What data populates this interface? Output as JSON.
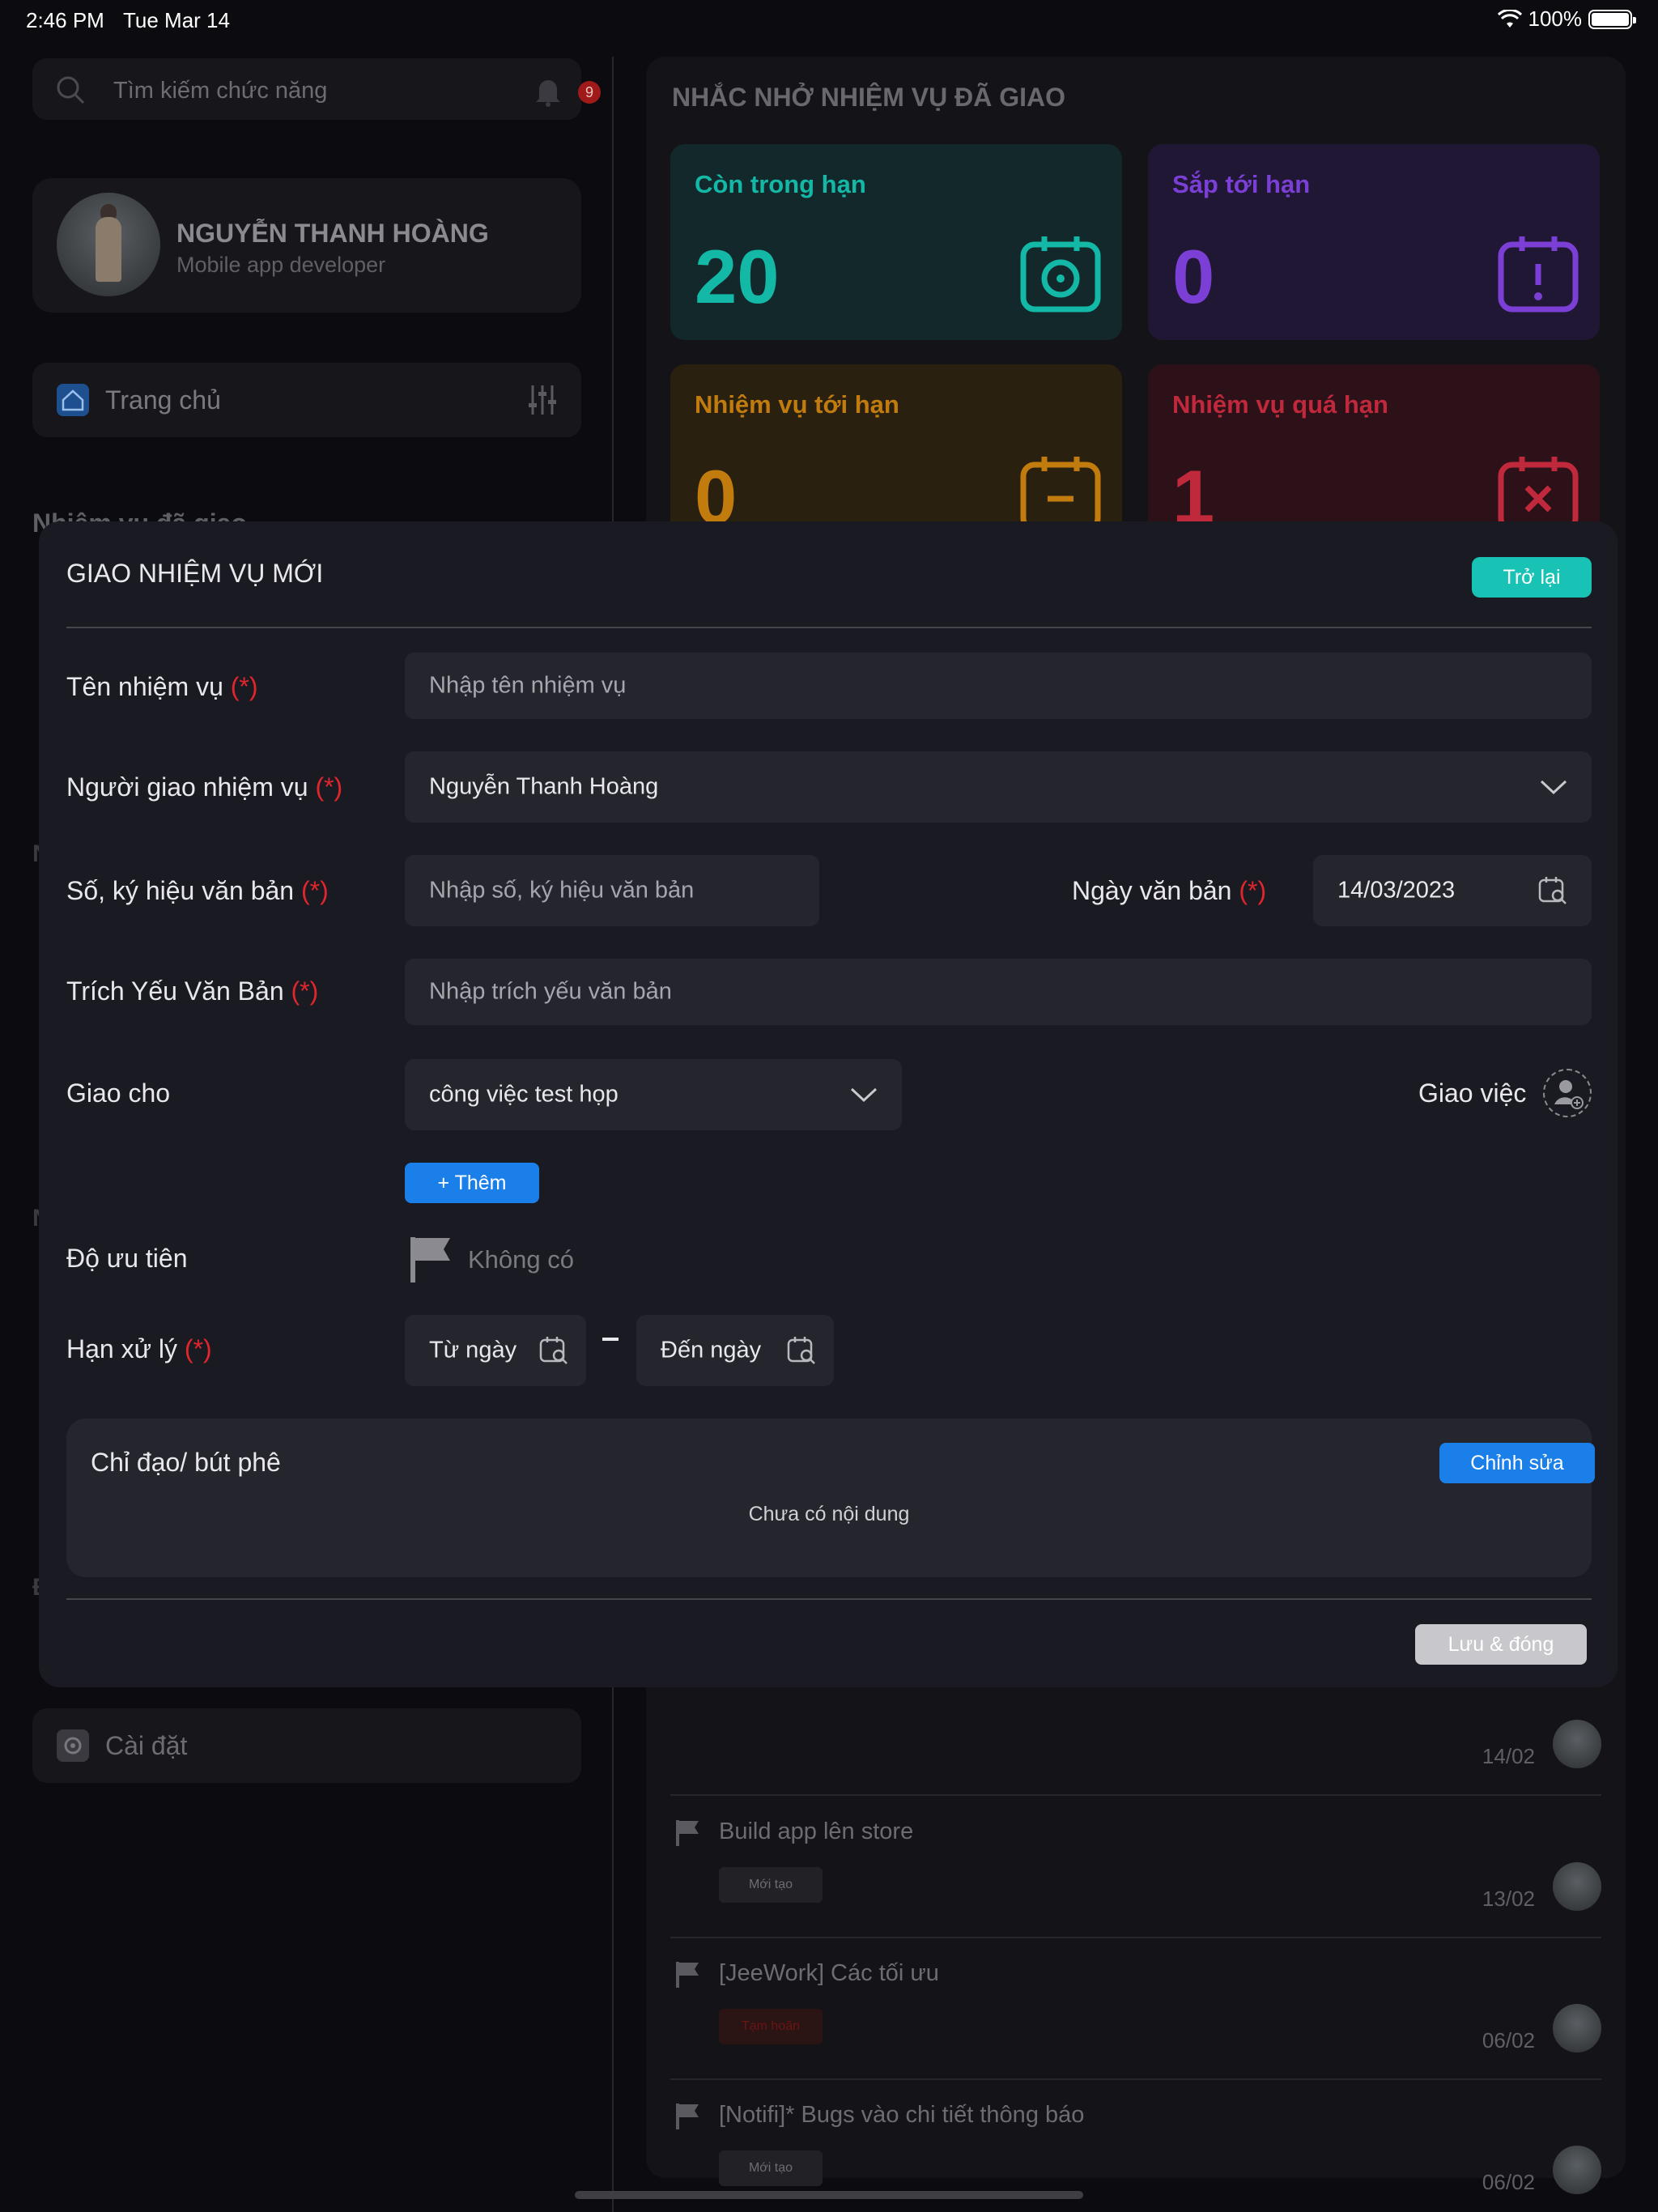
{
  "status_bar": {
    "time": "2:46 PM",
    "date": "Tue Mar 14",
    "battery": "100%"
  },
  "sidebar": {
    "search_placeholder": "Tìm kiếm chức năng",
    "notification_count": "9",
    "profile": {
      "name": "NGUYỄN THANH HOÀNG",
      "role": "Mobile app developer"
    },
    "home_label": "Trang chủ",
    "section_title": "Nhiệm vụ đã giao",
    "partial_letters": [
      "N",
      "N",
      "Đ"
    ],
    "settings_label": "Cài đặt"
  },
  "reminder": {
    "title": "NHẮC NHỞ NHIỆM VỤ ĐÃ GIAO",
    "cards": [
      {
        "label": "Còn trong hạn",
        "value": "20",
        "color": "#14b8a6",
        "bg": "#12282b",
        "icon": "alarm-clock-icon"
      },
      {
        "label": "Sắp tới hạn",
        "value": "0",
        "color": "#7b3fd6",
        "bg": "#1f1733",
        "icon": "calendar-alert-icon"
      },
      {
        "label": "Nhiệm vụ tới hạn",
        "value": "0",
        "color": "#c27c0e",
        "bg": "#2a2010",
        "icon": "calendar-minus-icon"
      },
      {
        "label": "Nhiệm vụ quá hạn",
        "value": "1",
        "color": "#c0283c",
        "bg": "#2c1118",
        "icon": "calendar-x-icon"
      }
    ]
  },
  "tasks": [
    {
      "title": "",
      "badge": "",
      "date": "14/02"
    },
    {
      "title": "Build app lên store",
      "badge": "Mới tạo",
      "date": "13/02"
    },
    {
      "title": "[JeeWork] Các tối ưu",
      "badge": "Tạm hoãn",
      "date": "06/02"
    },
    {
      "title": "[Notifi]* Bugs vào chi tiết thông báo",
      "badge": "Mới tạo",
      "date": "06/02"
    }
  ],
  "modal": {
    "title": "GIAO NHIỆM VỤ MỚI",
    "back_label": "Trở lại",
    "required_mark": "(*)",
    "fields": {
      "task_name": {
        "label": "Tên nhiệm vụ",
        "placeholder": "Nhập tên nhiệm vụ"
      },
      "assigner": {
        "label": "Người giao nhiệm vụ",
        "value": "Nguyễn Thanh Hoàng"
      },
      "doc_number": {
        "label": "Số, ký hiệu văn bản",
        "placeholder": "Nhập số, ký hiệu văn bản"
      },
      "doc_date": {
        "label": "Ngày văn bản",
        "value": "14/03/2023"
      },
      "doc_summary": {
        "label": "Trích Yếu Văn Bản",
        "placeholder": "Nhập trích yếu văn bản"
      },
      "assign_to": {
        "label": "Giao cho",
        "value": "công việc test họp",
        "assign_label": "Giao việc"
      },
      "add_label": "+ Thêm",
      "priority": {
        "label": "Độ ưu tiên",
        "value": "Không có"
      },
      "deadline": {
        "label": "Hạn xử lý",
        "from": "Từ ngày",
        "to": "Đến ngày"
      }
    },
    "comment": {
      "title": "Chỉ đạo/ bút phê",
      "edit_label": "Chỉnh sửa",
      "empty_text": "Chưa có nội dung"
    },
    "save_label": "Lưu & đóng"
  }
}
